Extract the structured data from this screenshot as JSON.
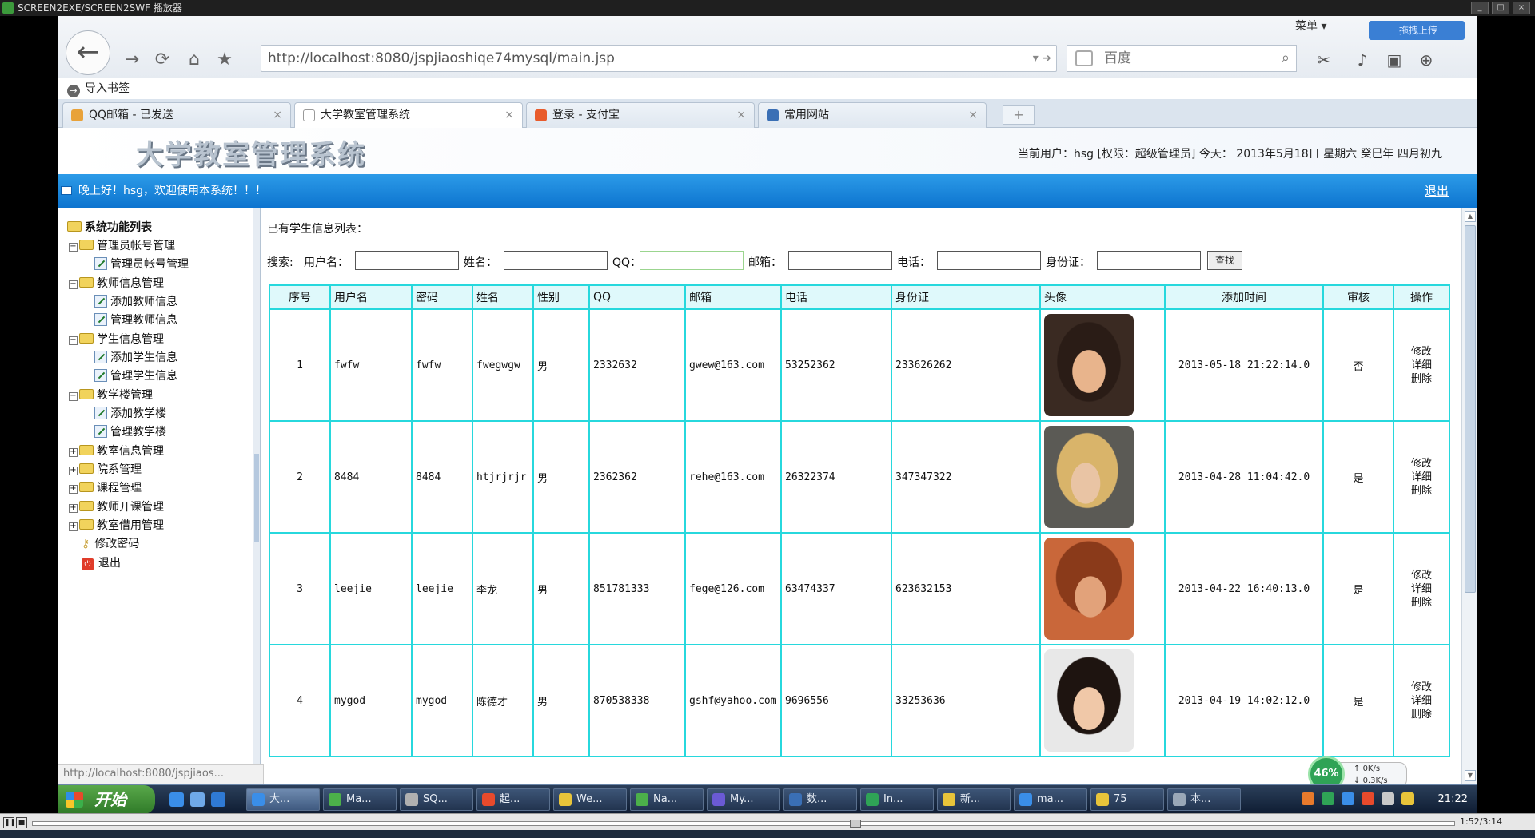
{
  "player": {
    "title": "SCREEN2EXE/SCREEN2SWF 播放器",
    "time": "1:52/3:14"
  },
  "browser": {
    "url": "http://localhost:8080/jspjiaoshiqe74mysql/main.jsp",
    "search_placeholder": "百度",
    "menu_label": "菜单",
    "upload_label": "拖拽上传",
    "bookmarks_label": "导入书签",
    "tabs": [
      {
        "title": "QQ邮箱 - 已发送",
        "color": "#e8a23a"
      },
      {
        "title": "大学教室管理系统",
        "color": "#ffffff"
      },
      {
        "title": "登录 - 支付宝",
        "color": "#e85b2c"
      },
      {
        "title": "常用网站",
        "color": "#3a6fb5"
      }
    ],
    "status_url": "http://localhost:8080/jspjiaos..."
  },
  "header": {
    "title": "大学教室管理系统",
    "user_info": "当前用户：hsg [权限：超级管理员] 今天： 2013年5月18日 星期六 癸巳年 四月初九",
    "welcome": "晚上好！hsg，欢迎使用本系统！！！",
    "logout": "退出"
  },
  "sidebar": {
    "root": "系统功能列表",
    "groups": [
      {
        "label": "管理员帐号管理",
        "children": [
          "管理员帐号管理"
        ]
      },
      {
        "label": "教师信息管理",
        "children": [
          "添加教师信息",
          "管理教师信息"
        ]
      },
      {
        "label": "学生信息管理",
        "children": [
          "添加学生信息",
          "管理学生信息"
        ]
      },
      {
        "label": "教学楼管理",
        "children": [
          "添加教学楼",
          "管理教学楼"
        ]
      },
      {
        "label": "教室信息管理"
      },
      {
        "label": "院系管理"
      },
      {
        "label": "课程管理"
      },
      {
        "label": "教师开课管理"
      },
      {
        "label": "教室借用管理"
      }
    ],
    "change_password": "修改密码",
    "exit": "退出"
  },
  "content": {
    "list_title": "已有学生信息列表：",
    "search": {
      "label": "搜索:",
      "fields": [
        "用户名：",
        "姓名：",
        "QQ：",
        "邮箱：",
        "电话：",
        "身份证："
      ],
      "button": "查找"
    },
    "table": {
      "headers": [
        "序号",
        "用户名",
        "密码",
        "姓名",
        "性别",
        "QQ",
        "邮箱",
        "电话",
        "身份证",
        "头像",
        "添加时间",
        "审核",
        "操作"
      ],
      "rows": [
        {
          "no": "1",
          "username": "fwfw",
          "password": "fwfw",
          "name": "fwegwgw",
          "gender": "男",
          "qq": "2332632",
          "email": "gwew@163.com",
          "phone": "53252362",
          "idcard": "233626262",
          "avatar": "female-dark-hair",
          "added": "2013-05-18 21:22:14.0",
          "audit": "否"
        },
        {
          "no": "2",
          "username": "8484",
          "password": "8484",
          "name": "htjrjrjr",
          "gender": "男",
          "qq": "2362362",
          "email": "rehe@163.com",
          "phone": "26322374",
          "idcard": "347347322",
          "avatar": "female-blonde",
          "added": "2013-04-28 11:04:42.0",
          "audit": "是"
        },
        {
          "no": "3",
          "username": "leejie",
          "password": "leejie",
          "name": "李龙",
          "gender": "男",
          "qq": "851781333",
          "email": "fege@126.com",
          "phone": "63474337",
          "idcard": "623632153",
          "avatar": "male-red-hair",
          "added": "2013-04-22 16:40:13.0",
          "audit": "是"
        },
        {
          "no": "4",
          "username": "mygod",
          "password": "mygod",
          "name": "陈德才",
          "gender": "男",
          "qq": "870538338",
          "email": "gshf@yahoo.com",
          "phone": "9696556",
          "idcard": "33253636",
          "avatar": "female-dark-hair-smile",
          "added": "2013-04-19 14:02:12.0",
          "audit": "是"
        }
      ],
      "ops": [
        "修改",
        "详细",
        "删除"
      ]
    }
  },
  "taskbar": {
    "start": "开始",
    "buttons": [
      "大...",
      "Ma...",
      "SQ...",
      "起...",
      "We...",
      "Na...",
      "My...",
      "数...",
      "In...",
      "新...",
      "ma...",
      "75",
      "本..."
    ],
    "clock": "21:22",
    "net_percent": "46%",
    "up_rate": "0K/s",
    "down_rate": "0.3K/s"
  }
}
